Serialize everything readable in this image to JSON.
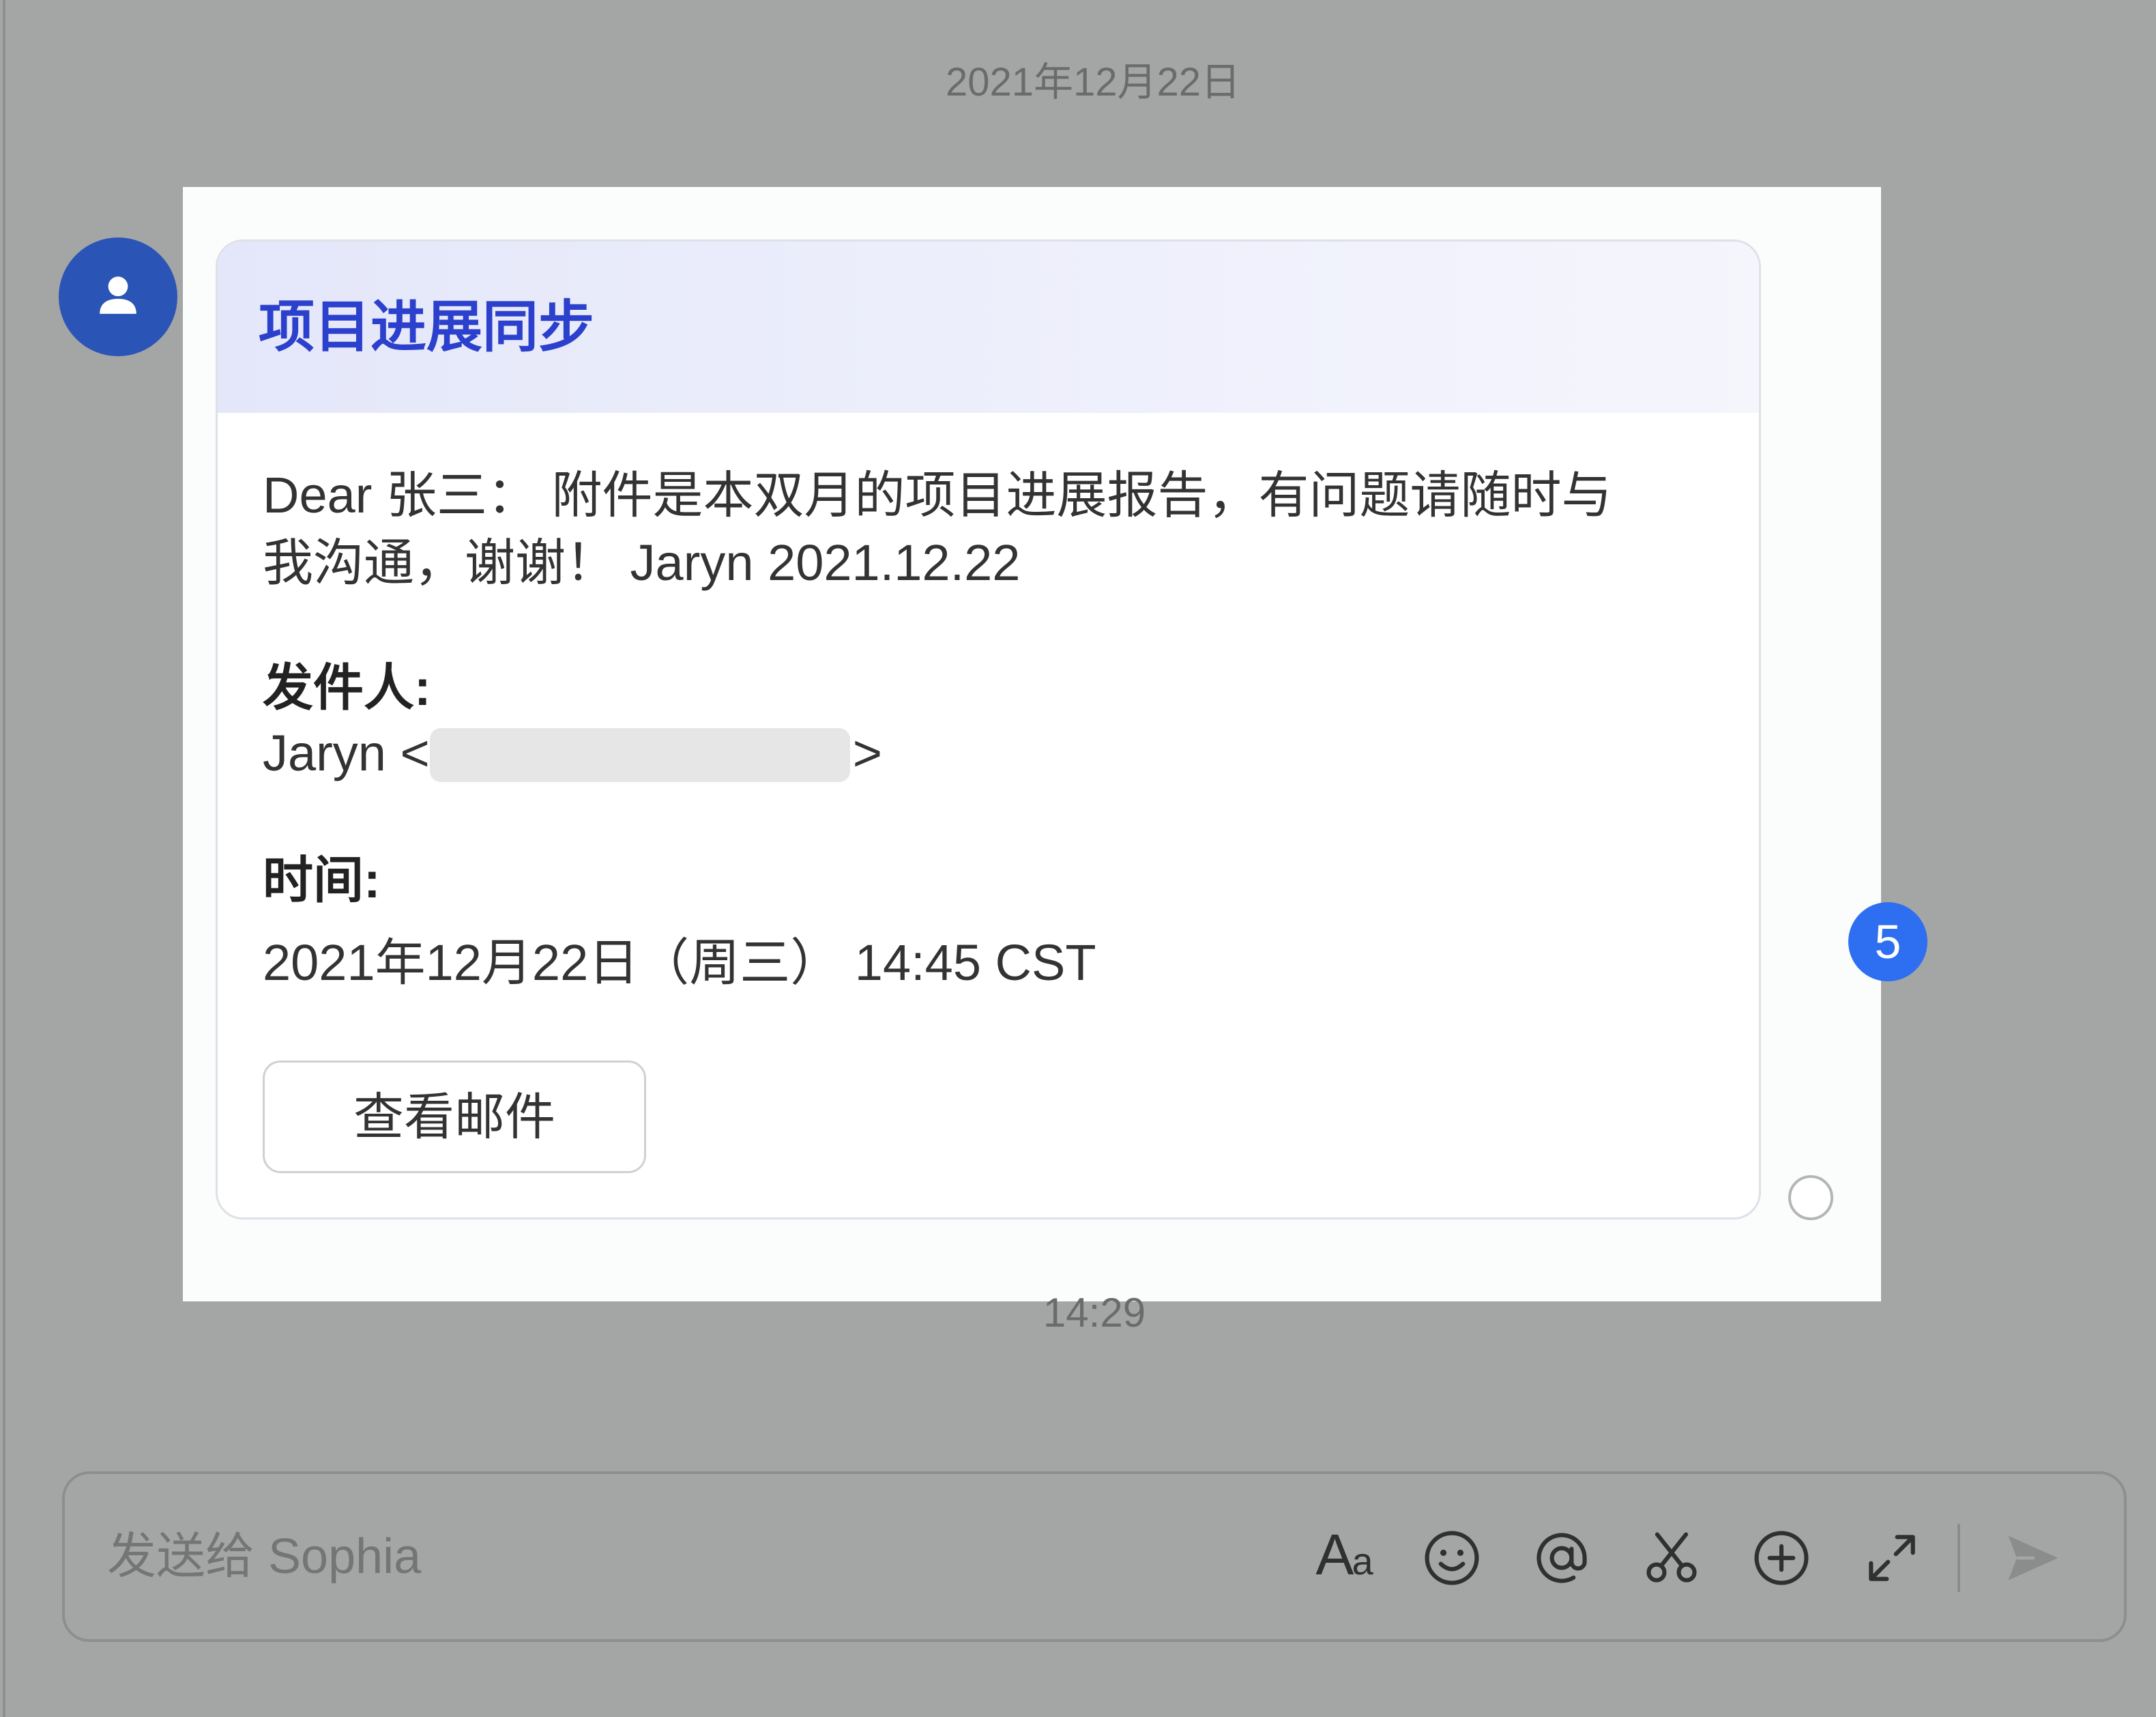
{
  "date_divider": "2021年12月22日",
  "conversation": {
    "sender_avatar_icon": "user-icon",
    "mail_card": {
      "title": "项目进展同步",
      "body": "Dear 张三： 附件是本双月的项目进展报告，有问题请随时与我沟通，谢谢！ Jaryn 2021.12.22",
      "sender": {
        "label": "发件人:",
        "name": "Jaryn <",
        "close": ">"
      },
      "time": {
        "label": "时间:",
        "value": "2021年12月22日（周三） 14:45 CST"
      },
      "view_button_label": "查看邮件"
    },
    "read_status_icon": "read-status-circle-icon",
    "step_badge": "5",
    "timestamp": "14:29"
  },
  "composer": {
    "placeholder": "发送给 Sophia",
    "value": "",
    "toolbar": {
      "format_label": "Aa",
      "icons": [
        "text-format-icon",
        "emoji-icon",
        "mention-icon",
        "scissors-icon",
        "add-circle-icon",
        "expand-icon",
        "send-icon"
      ]
    }
  },
  "colors": {
    "background": "#a4a6a5",
    "title": "#2b40cc",
    "avatar": "#2a55b6",
    "badge": "#2d6ff0",
    "text": "#333333",
    "muted": "#6a6c6b",
    "redact": "#e6e6e6"
  }
}
